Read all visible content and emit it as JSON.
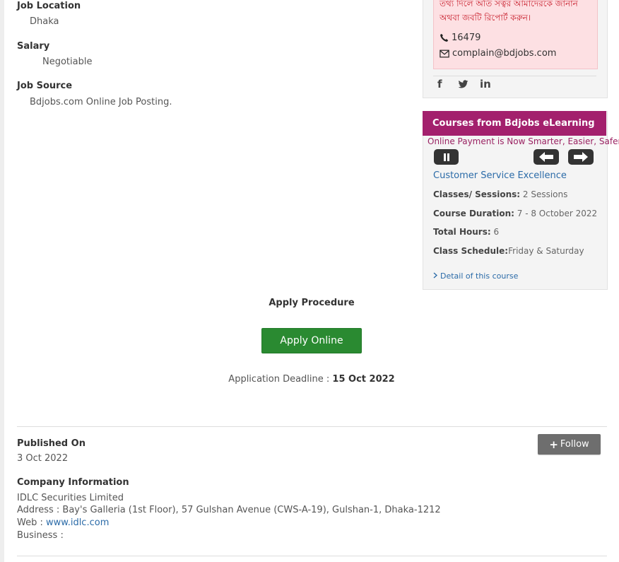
{
  "job": {
    "location_label": "Job Location",
    "location_value": "Dhaka",
    "salary_label": "Salary",
    "salary_value": "Negotiable",
    "source_label": "Job Source",
    "source_value": "Bdjobs.com Online Job Posting."
  },
  "complaint": {
    "line1": "তথ্য দিলে অতি সত্বর আমাদেরকে জানান",
    "line2": "অথবা জবটি রিপোর্ট করুন।",
    "phone": "16479",
    "email": "complain@bdjobs.com"
  },
  "social": {
    "facebook": "f",
    "twitter": "twitter-icon",
    "linkedin": "in"
  },
  "courses": {
    "header": "Courses from Bdjobs eLearning",
    "marquee": "Online Payment is Now Smarter, Easier, Safer",
    "course_title": "Customer Service Excellence",
    "sessions_label": "Classes/ Sessions:",
    "sessions_value": " 2 Sessions",
    "duration_label": "Course Duration:",
    "duration_value": " 7 - 8 October 2022",
    "hours_label": "Total Hours:",
    "hours_value": " 6",
    "schedule_label": "Class Schedule:",
    "schedule_value": "Friday & Saturday",
    "detail_link": "Detail of this course"
  },
  "apply": {
    "title": "Apply Procedure",
    "button": "Apply Online",
    "deadline_label": "Application Deadline : ",
    "deadline_value": "15 Oct 2022"
  },
  "company": {
    "follow_label": "Follow",
    "published_label": "Published On",
    "published_value": "3 Oct 2022",
    "info_label": "Company Information",
    "name": "IDLC Securities Limited",
    "address": "Address : Bay's Galleria (1st Floor), 57 Gulshan Avenue (CWS-A-19), Gulshan-1, Dhaka-1212",
    "web_label": "Web : ",
    "web_value": "www.idlc.com",
    "business_label": "Business :"
  },
  "colors": {
    "course_header": "#a3206d",
    "apply_button": "#2a8a31",
    "link": "#2b6ba8",
    "complaint_text": "#c9202e"
  }
}
